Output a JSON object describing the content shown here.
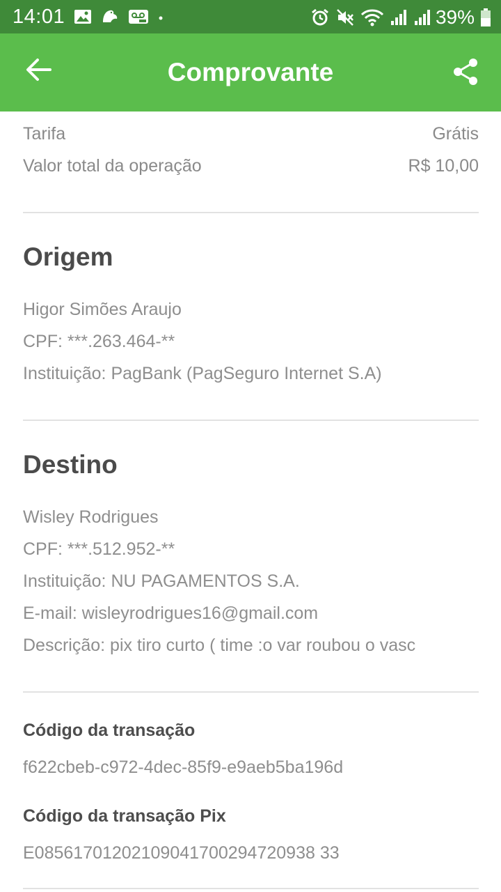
{
  "status_bar": {
    "time": "14:01",
    "battery": "39%",
    "icons_left": [
      "gallery-icon",
      "pigeon-icon",
      "voicemail-icon",
      "dot-icon"
    ],
    "icons_right": [
      "alarm-icon",
      "mute-icon",
      "wifi-icon",
      "signal-icon",
      "signal-icon",
      "battery-icon"
    ]
  },
  "app_bar": {
    "title": "Comprovante",
    "back_icon": "arrow-left-icon",
    "share_icon": "share-icon"
  },
  "summary": {
    "fee_label": "Tarifa",
    "fee_value": "Grátis",
    "total_label": "Valor total da operação",
    "total_value": "R$ 10,00"
  },
  "origin": {
    "title": "Origem",
    "name": "Higor Simões Araujo",
    "cpf": "CPF:  ***.263.464-**",
    "institution": "Instituição: PagBank (PagSeguro Internet S.A)"
  },
  "destination": {
    "title": "Destino",
    "name": "Wisley Rodrigues",
    "cpf": "CPF:  ***.512.952-**",
    "institution": "Instituição: NU PAGAMENTOS S.A.",
    "email": "E-mail:  wisleyrodrigues16@gmail.com",
    "description": "Descrição:  pix tiro curto ( time :o var roubou o vasc"
  },
  "transaction": {
    "code_label": "Código da transação",
    "code_value": "f622cbeb-c972-4dec-85f9-e9aeb5ba196d",
    "pix_label": "Código da transação Pix",
    "pix_value": "E08561701202109041700294720938 33"
  },
  "colors": {
    "app_bar": "#5bbd4c",
    "status_bar": "#3f8a39"
  }
}
